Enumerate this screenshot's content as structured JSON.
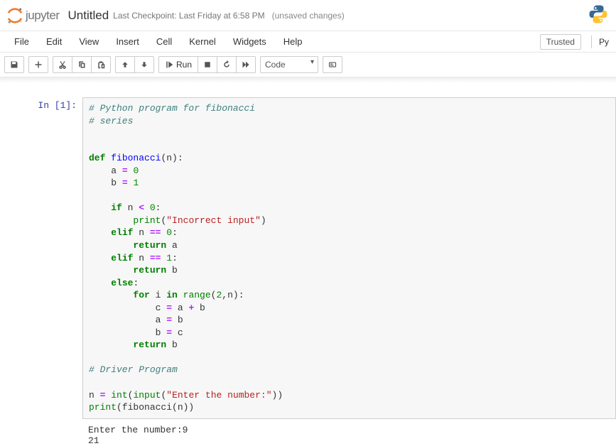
{
  "header": {
    "logo_text": "jupyter",
    "notebook_name": "Untitled",
    "checkpoint": "Last Checkpoint: Last Friday at 6:58 PM",
    "unsaved": "(unsaved changes)"
  },
  "menu": {
    "file": "File",
    "edit": "Edit",
    "view": "View",
    "insert": "Insert",
    "cell": "Cell",
    "kernel": "Kernel",
    "widgets": "Widgets",
    "help": "Help",
    "trusted": "Trusted",
    "kernel_name": "Py"
  },
  "toolbar": {
    "run_label": "Run",
    "cell_type": "Code"
  },
  "cell": {
    "prompt": "In [1]:",
    "code_tokens": [
      {
        "t": "# Python program for fibonacci",
        "c": "cm"
      },
      {
        "t": "\n"
      },
      {
        "t": "# series",
        "c": "cm"
      },
      {
        "t": "\n\n\n"
      },
      {
        "t": "def",
        "c": "kw"
      },
      {
        "t": " "
      },
      {
        "t": "fibonacci",
        "c": "fn"
      },
      {
        "t": "(n):\n"
      },
      {
        "t": "    a "
      },
      {
        "t": "=",
        "c": "op"
      },
      {
        "t": " "
      },
      {
        "t": "0",
        "c": "num"
      },
      {
        "t": "\n"
      },
      {
        "t": "    b "
      },
      {
        "t": "=",
        "c": "op"
      },
      {
        "t": " "
      },
      {
        "t": "1",
        "c": "num"
      },
      {
        "t": "\n\n"
      },
      {
        "t": "    "
      },
      {
        "t": "if",
        "c": "kw"
      },
      {
        "t": " n "
      },
      {
        "t": "<",
        "c": "op"
      },
      {
        "t": " "
      },
      {
        "t": "0",
        "c": "num"
      },
      {
        "t": ":\n"
      },
      {
        "t": "        "
      },
      {
        "t": "print",
        "c": "bi"
      },
      {
        "t": "("
      },
      {
        "t": "\"Incorrect input\"",
        "c": "str"
      },
      {
        "t": ")\n"
      },
      {
        "t": "    "
      },
      {
        "t": "elif",
        "c": "kw"
      },
      {
        "t": " n "
      },
      {
        "t": "==",
        "c": "op"
      },
      {
        "t": " "
      },
      {
        "t": "0",
        "c": "num"
      },
      {
        "t": ":\n"
      },
      {
        "t": "        "
      },
      {
        "t": "return",
        "c": "kw"
      },
      {
        "t": " a\n"
      },
      {
        "t": "    "
      },
      {
        "t": "elif",
        "c": "kw"
      },
      {
        "t": " n "
      },
      {
        "t": "==",
        "c": "op"
      },
      {
        "t": " "
      },
      {
        "t": "1",
        "c": "num"
      },
      {
        "t": ":\n"
      },
      {
        "t": "        "
      },
      {
        "t": "return",
        "c": "kw"
      },
      {
        "t": " b\n"
      },
      {
        "t": "    "
      },
      {
        "t": "else",
        "c": "kw"
      },
      {
        "t": ":\n"
      },
      {
        "t": "        "
      },
      {
        "t": "for",
        "c": "kw"
      },
      {
        "t": " i "
      },
      {
        "t": "in",
        "c": "kw"
      },
      {
        "t": " "
      },
      {
        "t": "range",
        "c": "bi"
      },
      {
        "t": "("
      },
      {
        "t": "2",
        "c": "num"
      },
      {
        "t": ",n):\n"
      },
      {
        "t": "            c "
      },
      {
        "t": "=",
        "c": "op"
      },
      {
        "t": " a "
      },
      {
        "t": "+",
        "c": "op"
      },
      {
        "t": " b\n"
      },
      {
        "t": "            a "
      },
      {
        "t": "=",
        "c": "op"
      },
      {
        "t": " b\n"
      },
      {
        "t": "            b "
      },
      {
        "t": "=",
        "c": "op"
      },
      {
        "t": " c\n"
      },
      {
        "t": "        "
      },
      {
        "t": "return",
        "c": "kw"
      },
      {
        "t": " b\n\n"
      },
      {
        "t": "# Driver Program",
        "c": "cm"
      },
      {
        "t": "\n\n"
      },
      {
        "t": "n "
      },
      {
        "t": "=",
        "c": "op"
      },
      {
        "t": " "
      },
      {
        "t": "int",
        "c": "bi"
      },
      {
        "t": "("
      },
      {
        "t": "input",
        "c": "bi"
      },
      {
        "t": "("
      },
      {
        "t": "\"Enter the number:\"",
        "c": "str"
      },
      {
        "t": "))\n"
      },
      {
        "t": "print",
        "c": "bi"
      },
      {
        "t": "(fibonacci(n))"
      }
    ],
    "output": "Enter the number:9\n21"
  }
}
